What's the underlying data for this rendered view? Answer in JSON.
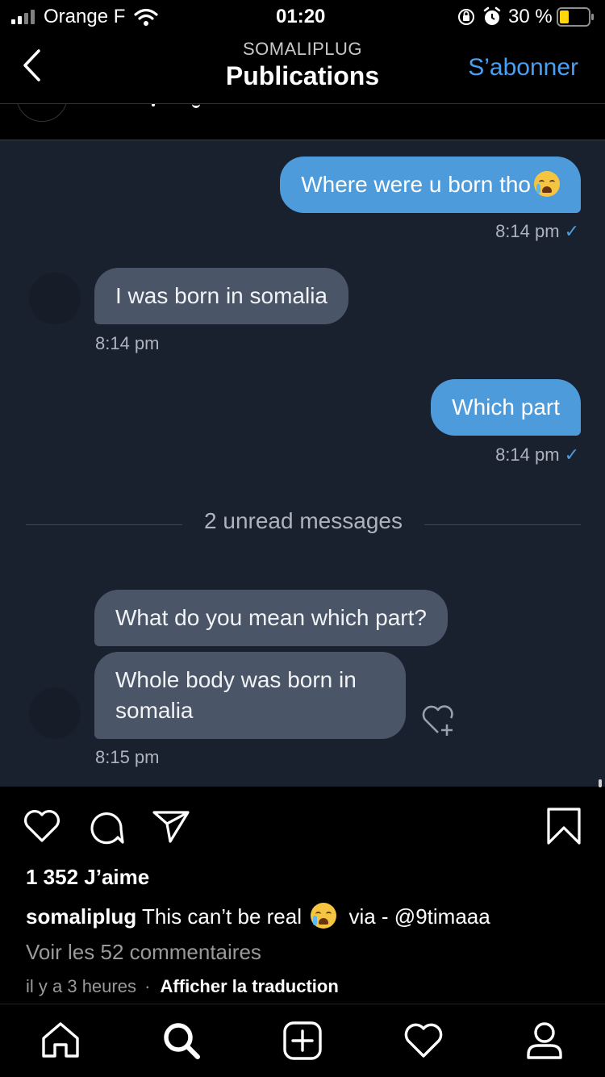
{
  "status_bar": {
    "carrier": "Orange F",
    "time": "01:20",
    "battery": "30 %"
  },
  "nav": {
    "subtitle": "SOMALIPLUG",
    "title": "Publications",
    "action": "S’abonner"
  },
  "chat": {
    "messages": [
      {
        "dir": "out",
        "text": "Where were u born tho",
        "time": "8:14 pm",
        "check": "✓"
      },
      {
        "dir": "in",
        "text": "I was born in somalia",
        "time": "8:14 pm"
      },
      {
        "dir": "out",
        "text": "Which part",
        "time": "8:14 pm",
        "check": "✓"
      },
      {
        "dir": "in",
        "text": "What do you mean which part?"
      },
      {
        "dir": "in",
        "text": "Whole body was born in somalia",
        "time": "8:15 pm"
      }
    ],
    "unread_divider": "2 unread messages"
  },
  "post": {
    "likes": "1 352 J’aime",
    "username": "somaliplug",
    "caption": "This can’t be real",
    "caption_suffix": "via - @9timaaa",
    "comments": "Voir les 52 commentaires",
    "time_ago": "il y a 3 heures",
    "separator": "·",
    "translate": "Afficher la traduction"
  },
  "colors": {
    "accent": "#4a9ff2",
    "outgoing_bubble": "#4e9bdc",
    "incoming_bubble": "#4a5567",
    "chat_bg": "#1a212e"
  },
  "icons": [
    "signal-icon",
    "wifi-icon",
    "orientation-lock-icon",
    "alarm-icon",
    "battery-icon",
    "back-chevron-icon",
    "heart-icon",
    "comment-icon",
    "share-icon",
    "bookmark-icon",
    "home-icon",
    "search-icon",
    "add-post-icon",
    "activity-heart-icon",
    "profile-icon",
    "heart-plus-icon",
    "crying-emoji-icon"
  ]
}
